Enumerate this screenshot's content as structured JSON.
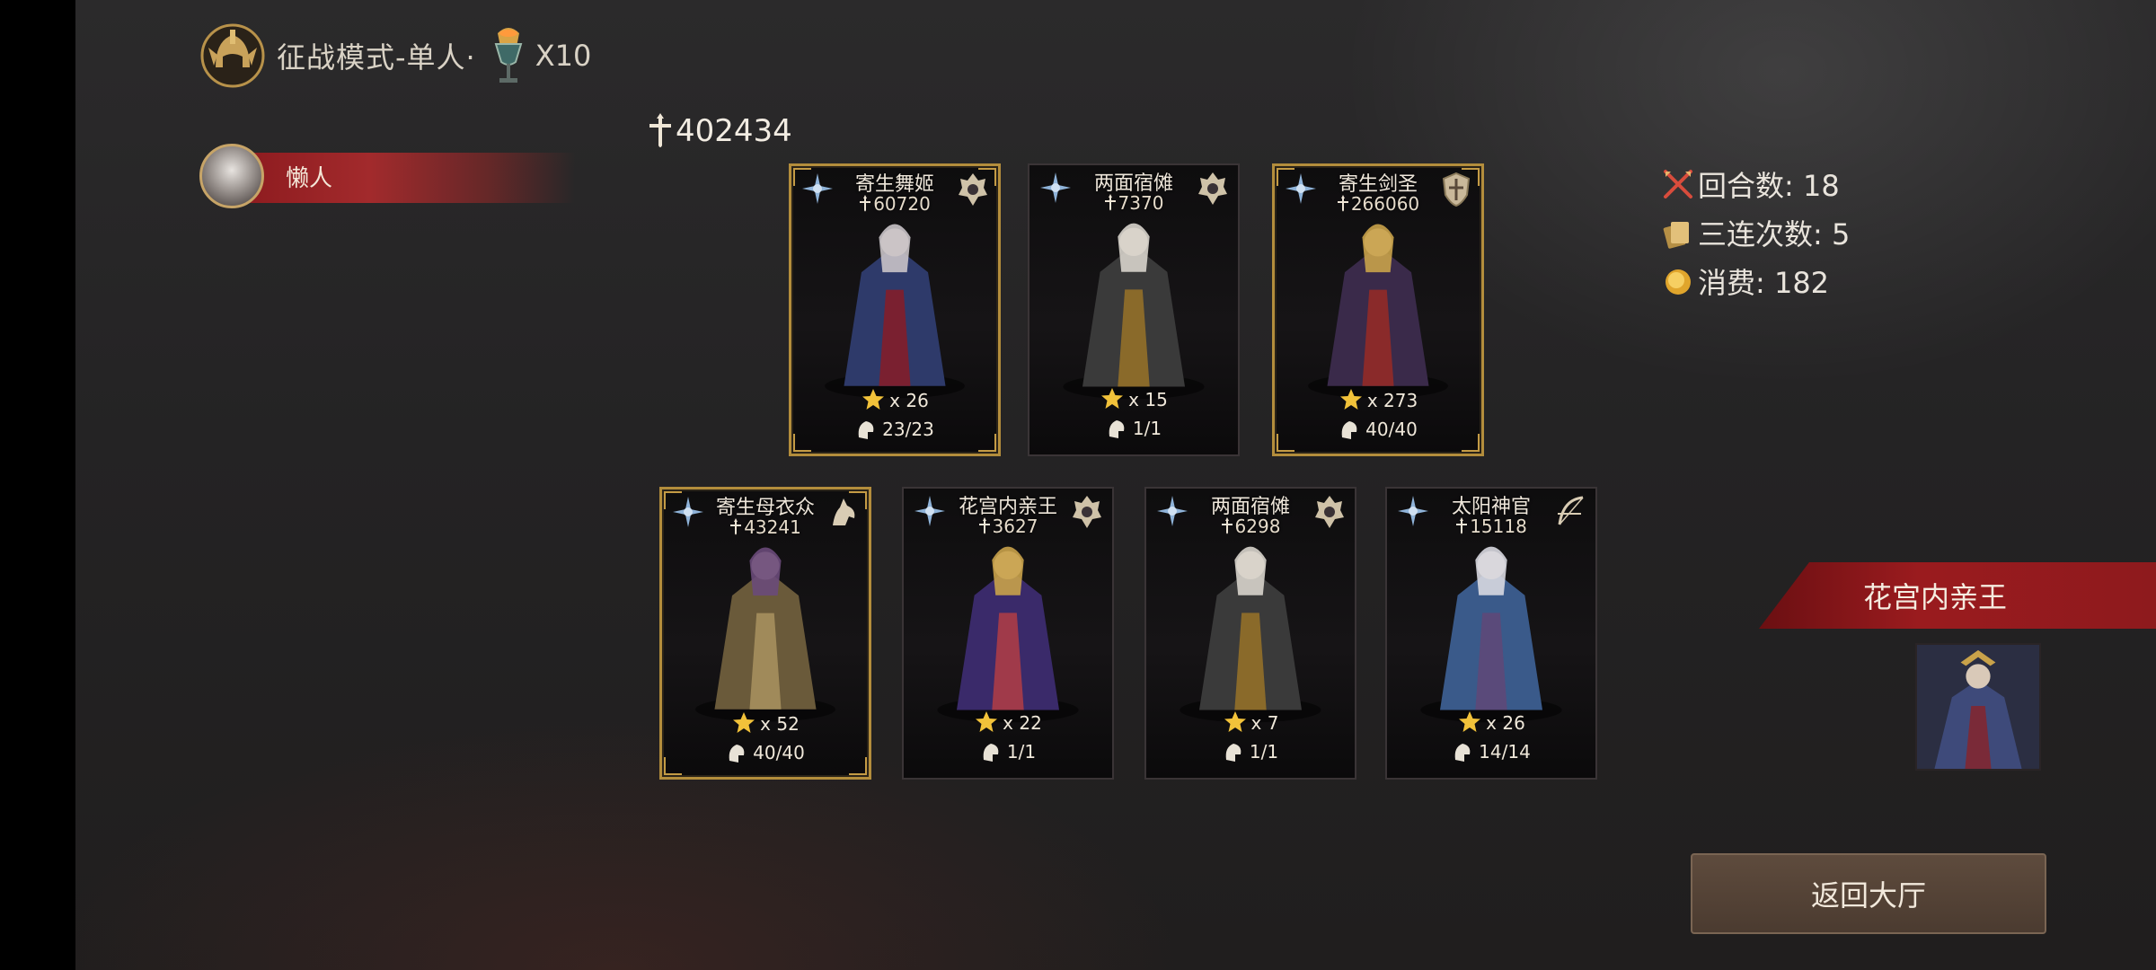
{
  "header": {
    "mode_title": "征战模式-单人·",
    "multiplier": "X10",
    "helmet_icon": "helmet-crest-icon",
    "goblet_icon": "goblet-icon"
  },
  "player": {
    "name": "懒人",
    "accent": "#a22a2c"
  },
  "total_power": "402434",
  "cards": [
    {
      "name": "寄生舞姬",
      "power": "60720",
      "stars": "x 26",
      "troops": "23/23",
      "gold": true,
      "element_icon": "star-compass-icon",
      "class_icon": "crest-icon"
    },
    {
      "name": "两面宿傩",
      "power": "7370",
      "stars": "x 15",
      "troops": "1/1",
      "gold": false,
      "element_icon": "star-compass-icon",
      "class_icon": "crest-icon"
    },
    {
      "name": "寄生剑圣",
      "power": "266060",
      "stars": "x 273",
      "troops": "40/40",
      "gold": true,
      "element_icon": "star-compass-icon",
      "class_icon": "shield-icon"
    },
    {
      "name": "寄生母衣众",
      "power": "43241",
      "stars": "x 52",
      "troops": "40/40",
      "gold": true,
      "element_icon": "star-compass-icon",
      "class_icon": "horse-head-icon"
    },
    {
      "name": "花宫内亲王",
      "power": "3627",
      "stars": "x 22",
      "troops": "1/1",
      "gold": false,
      "element_icon": "star-compass-icon",
      "class_icon": "crest-icon"
    },
    {
      "name": "两面宿傩",
      "power": "6298",
      "stars": "x 7",
      "troops": "1/1",
      "gold": false,
      "element_icon": "star-compass-icon",
      "class_icon": "crest-icon"
    },
    {
      "name": "太阳神官",
      "power": "15118",
      "stars": "x 26",
      "troops": "14/14",
      "gold": false,
      "element_icon": "star-compass-icon",
      "class_icon": "bow-icon"
    }
  ],
  "stats": {
    "rounds": "回合数: 18",
    "triples": "三连次数: 5",
    "cost": "消费: 182"
  },
  "featured": {
    "name": "花宫内亲王"
  },
  "buttons": {
    "return": "返回大厅"
  },
  "colors": {
    "gold_border": "#b38d3c",
    "banner_red": "#9a1b1e",
    "button_brown": "#5e4b3d"
  }
}
